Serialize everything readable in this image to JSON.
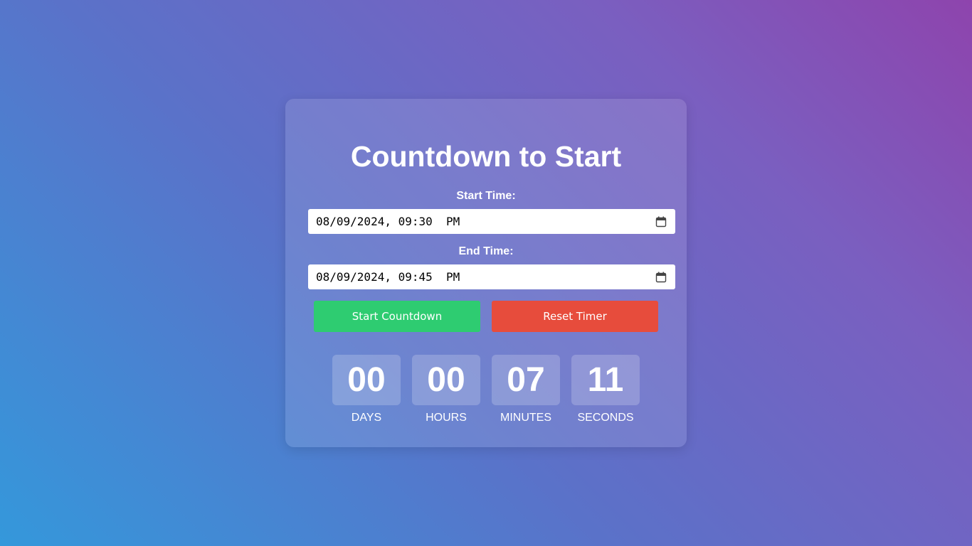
{
  "title": "Countdown to Start",
  "start": {
    "label": "Start Time:",
    "value": "08/09/2024, 09:30  PM"
  },
  "end": {
    "label": "End Time:",
    "value": "08/09/2024, 09:45  PM"
  },
  "buttons": {
    "start_label": "Start Countdown",
    "reset_label": "Reset Timer"
  },
  "countdown": {
    "days": {
      "value": "00",
      "label": "DAYS"
    },
    "hours": {
      "value": "00",
      "label": "HOURS"
    },
    "minutes": {
      "value": "07",
      "label": "MINUTES"
    },
    "seconds": {
      "value": "11",
      "label": "SECONDS"
    }
  },
  "icons": {
    "calendar": "calendar-icon"
  },
  "colors": {
    "start_button": "#2ecc71",
    "reset_button": "#e74c3c"
  }
}
